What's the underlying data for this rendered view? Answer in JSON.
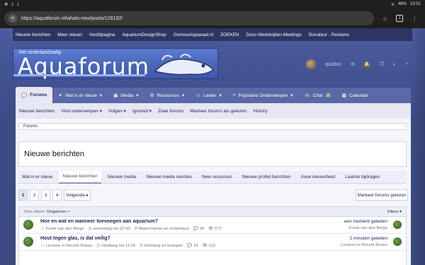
{
  "statusbar": {
    "battery": "48%",
    "time": "19:51"
  },
  "browser": {
    "url": "https://aquaforum.nl/whats-new/posts/126192/",
    "tabs": "1"
  },
  "topnav": [
    "Nieuwe berichten",
    "Meer nieuw!",
    "Hoofdpagina",
    "AquariumDesignShop",
    "OsmoseApparaat.nl",
    "ZOEKEN",
    "Docs-Wedstrijden-Meetings",
    "Donateur - Reclame"
  ],
  "logo": {
    "tagline": "het nederlandstalig",
    "name": "Aquaforum"
  },
  "user": {
    "name": "quicbro"
  },
  "mainnav": [
    {
      "label": "Forums",
      "icon": "comments-icon"
    },
    {
      "label": "Wat is er nieuw",
      "icon": "star-icon"
    },
    {
      "label": "Media",
      "icon": "image-icon"
    },
    {
      "label": "Resources",
      "icon": "cog-icon"
    },
    {
      "label": "Leden",
      "icon": "user-icon"
    },
    {
      "label": "Populaire Onderwerpen",
      "icon": "tag-icon"
    },
    {
      "label": "Chat",
      "icon": "chat-icon",
      "badge": "2"
    },
    {
      "label": "Calendar",
      "icon": "calendar-icon"
    }
  ],
  "subnav": [
    "Nieuwe berichten",
    "Vind onderwerpen",
    "Volgen",
    "Ignored",
    "Zoek forums",
    "Markeer forums als gelezen",
    "History"
  ],
  "breadcrumb": "Forums",
  "page_title": "Nieuwe berichten",
  "content_tabs": [
    "Wat is er nieuw",
    "Nieuwe berichten",
    "Nieuwe media",
    "Nieuwe media reacties",
    "New resources",
    "Nieuwe profiel berichten",
    "Jouw nieuwsfeed",
    "Laatste bijdragen"
  ],
  "pager": {
    "pages": [
      "1",
      "2",
      "3",
      "4"
    ],
    "next": "Volgende"
  },
  "mark_read": "Markeer forums gelezen",
  "filter": {
    "label": "Toon alleen:",
    "value": "Ongelezen",
    "filters": "Filters"
  },
  "threads": [
    {
      "title": "Hoe en wat en wanneer toevoegen aan aquarium?",
      "author": "Frank van den Berge",
      "date": "woensdag om 22:42",
      "forum": "Waterchemie en onderhoud",
      "replies": "28",
      "views": "272",
      "last_time": "een moment geleden",
      "last_user": "Frank van den Berge"
    },
    {
      "title": "Hout tegen glas, is dat veilig?",
      "author": "Lecturer in Recent Runes",
      "date": "Vandaag om 11:25",
      "forum": "Inrichting en biotopen",
      "replies": "14",
      "views": "110",
      "last_time": "2 minuten geleden",
      "last_user": "Lecturer in Recent Runes"
    }
  ]
}
